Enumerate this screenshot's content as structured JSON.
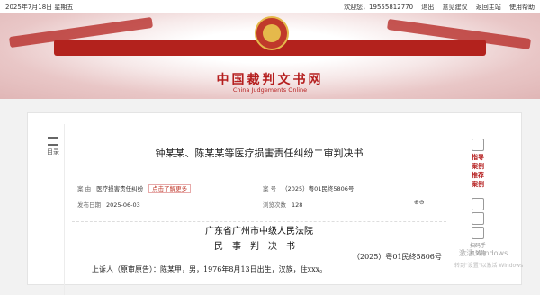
{
  "topbar": {
    "date": "2025年7月18日 星期五",
    "welcome": "欢迎您，19555812770",
    "logout": "退出",
    "feedback": "意见建议",
    "home": "返回主站",
    "help": "使用帮助"
  },
  "banner": {
    "title": "中国裁判文书网",
    "subtitle": "China Judgements Online"
  },
  "leftnav": {
    "label": "目录"
  },
  "document": {
    "title": "钟某某、陈某某等医疗损害责任纠纷二审判决书",
    "cause_label": "案   由",
    "cause_value": "医疗损害责任纠纷",
    "cause_tag": "点击了解更多",
    "case_no_label": "案   号",
    "case_no_value": "（2025）粤01民终5806号",
    "publish_label": "发布日期",
    "publish_value": "2025-06-03",
    "views_label": "浏览次数",
    "views_value": "128",
    "court": "广东省广州市中级人民法院",
    "doc_type": "民事判决书",
    "case_number": "（2025）粤01民终5806号",
    "party_line": "上诉人（原审原告）：陈某甲，男，1976年8月13日出生，汉族，住xxx。"
  },
  "rightnav": {
    "item1": "指导",
    "item2": "案例",
    "item3": "推荐",
    "item4": "案例",
    "scan_label": "扫码手机浏览"
  },
  "watermark": {
    "line1": "激活 Windows",
    "line2": "转到\"设置\"以激活 Windows"
  },
  "colors": {
    "brand_red": "#b51e1e",
    "accent": "#c0392b"
  }
}
